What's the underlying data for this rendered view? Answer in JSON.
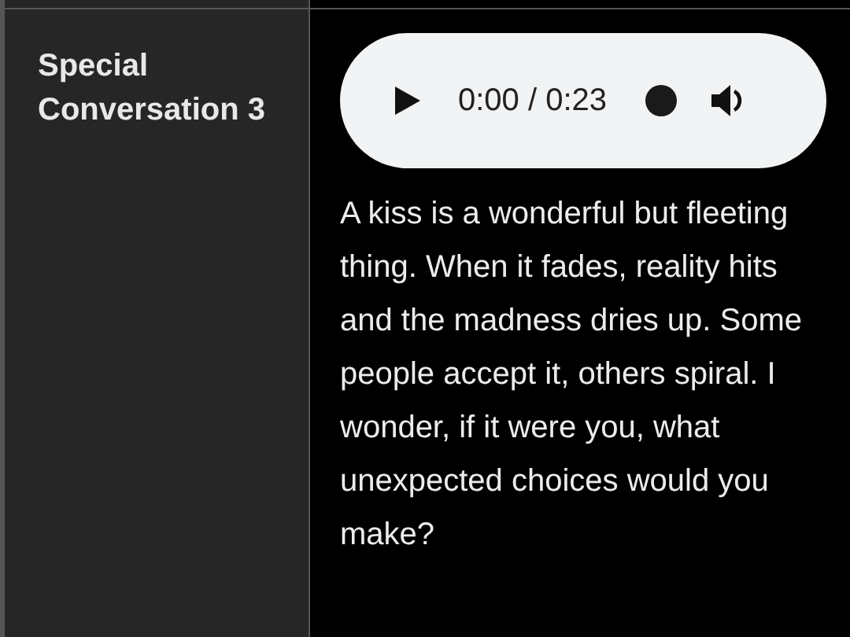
{
  "row": {
    "heading": "Special Conversation 3",
    "audio_player": {
      "time": "0:00 / 0:23"
    },
    "text": "A kiss is a wonderful but fleeting thing. When it fades, reality hits and the madness dries up. Some people accept it, others spiral. I wonder, if it were you, what unexpected choices would you make?"
  }
}
